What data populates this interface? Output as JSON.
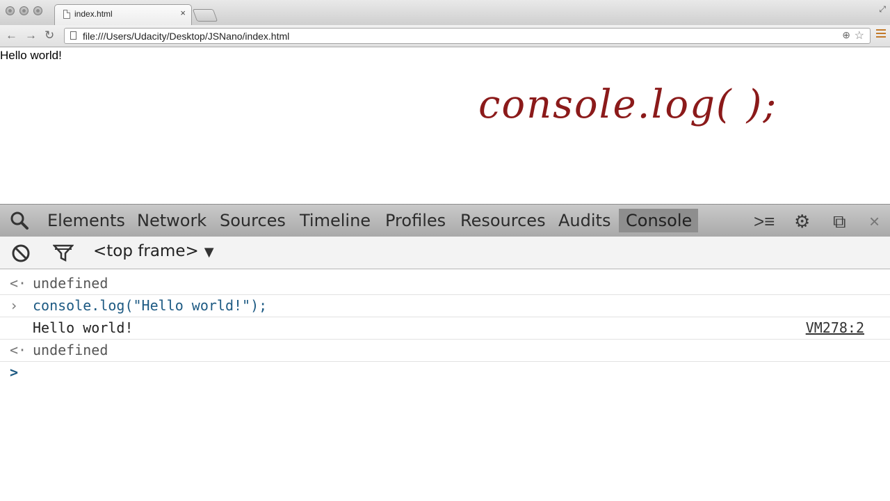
{
  "browser": {
    "tab_title": "index.html",
    "tab_close": "×",
    "url": "file:///Users/Udacity/Desktop/JSNano/index.html"
  },
  "page": {
    "text": "Hello world!",
    "handwritten_note": "console.log( );"
  },
  "devtools": {
    "tabs": [
      "Elements",
      "Network",
      "Sources",
      "Timeline",
      "Profiles",
      "Resources",
      "Audits",
      "Console"
    ],
    "active_tab": "Console"
  },
  "console_toolbar": {
    "frame_selector": "<top frame>"
  },
  "console": {
    "rows": [
      {
        "type": "result",
        "gutter": "<",
        "text": "undefined"
      },
      {
        "type": "command",
        "gutter": ">",
        "text": "console.log(\"Hello world!\");"
      },
      {
        "type": "log",
        "gutter": "",
        "text": "Hello world!",
        "source": "VM278:2"
      },
      {
        "type": "result",
        "gutter": "<",
        "text": "undefined"
      }
    ],
    "prompt_symbol": ">"
  },
  "colors": {
    "command_text": "#1d5a83",
    "handwriting": "#8b1a1a"
  }
}
